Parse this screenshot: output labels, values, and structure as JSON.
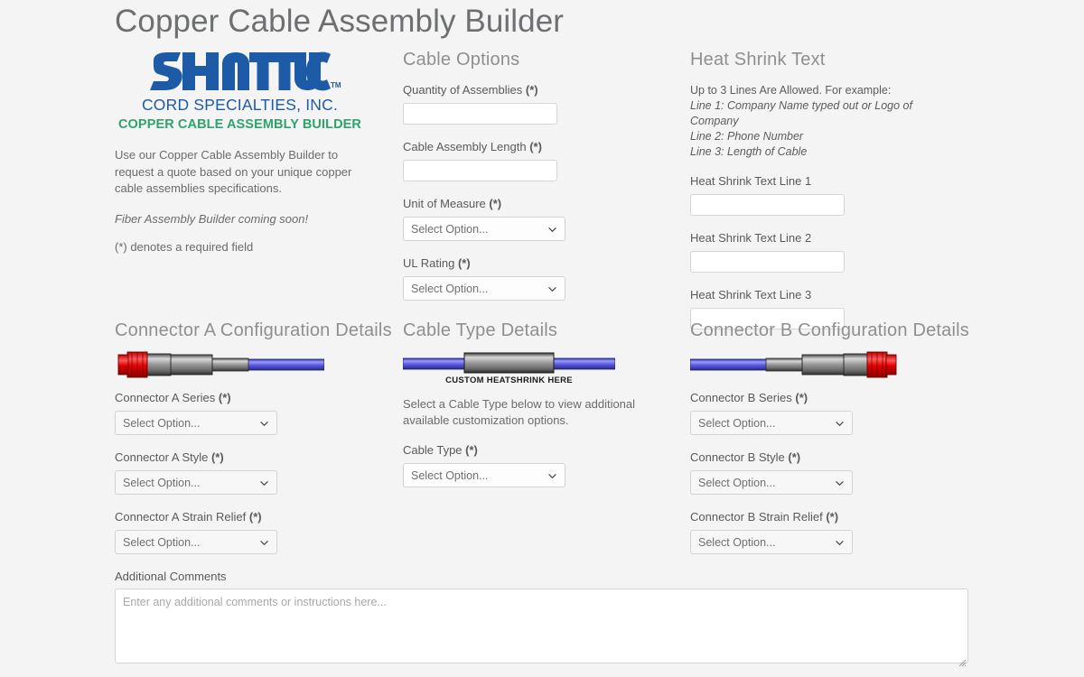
{
  "page": {
    "title": "Copper Cable Assembly Builder",
    "background_color": "#f4f4f4"
  },
  "brand": {
    "wordmark": "SHATTUC",
    "trademark": "TM",
    "subtitle": "CORD SPECIALTIES, INC.",
    "tagline": "COPPER CABLE ASSEMBLY BUILDER",
    "brand_blue": "#1d5ba6",
    "brand_green": "#2fa36b"
  },
  "intro": {
    "paragraph": "Use our Copper Cable Assembly Builder to request a quote based on your unique copper cable assemblies specifications.",
    "italic_note": "Fiber Assembly Builder coming soon!",
    "required_note": "(*) denotes a required field"
  },
  "cable_options": {
    "heading": "Cable Options",
    "quantity": {
      "label": "Quantity of Assemblies",
      "required_marker": "(*)",
      "value": "",
      "placeholder": ""
    },
    "length": {
      "label": "Cable Assembly Length",
      "required_marker": "(*)",
      "value": "",
      "placeholder": ""
    },
    "unit_of_measure": {
      "label": "Unit of Measure",
      "required_marker": "(*)",
      "selected": "Select Option..."
    },
    "ul_rating": {
      "label": "UL Rating",
      "required_marker": "(*)",
      "selected": "Select Option..."
    }
  },
  "heat_shrink": {
    "heading": "Heat Shrink Text",
    "example_intro": "Up to 3 Lines Are Allowed. For example:",
    "example_line_1": "Line 1: Company Name typed out or Logo of Company",
    "example_line_2": "Line 2: Phone Number",
    "example_line_3": "Line 3: Length of Cable",
    "line1": {
      "label": "Heat Shrink Text Line 1",
      "value": "",
      "placeholder": ""
    },
    "line2": {
      "label": "Heat Shrink Text Line 2",
      "value": "",
      "placeholder": ""
    },
    "line3": {
      "label": "Heat Shrink Text Line 3",
      "value": "",
      "placeholder": ""
    }
  },
  "connector_a": {
    "heading": "Connector A Configuration Details",
    "series": {
      "label": "Connector A Series",
      "required_marker": "(*)",
      "selected": "Select Option..."
    },
    "style": {
      "label": "Connector A Style",
      "required_marker": "(*)",
      "selected": "Select Option..."
    },
    "strain_relief": {
      "label": "Connector A Strain Relief",
      "required_marker": "(*)",
      "selected": "Select Option..."
    }
  },
  "cable_type": {
    "heading": "Cable Type Details",
    "graphic_caption": "CUSTOM HEATSHRINK HERE",
    "helper_text": "Select a Cable Type below to view additional available customization options.",
    "type": {
      "label": "Cable Type",
      "required_marker": "(*)",
      "selected": "Select Option..."
    }
  },
  "connector_b": {
    "heading": "Connector B Configuration Details",
    "series": {
      "label": "Connector B Series",
      "required_marker": "(*)",
      "selected": "Select Option..."
    },
    "style": {
      "label": "Connector B Style",
      "required_marker": "(*)",
      "selected": "Select Option..."
    },
    "strain_relief": {
      "label": "Connector B Strain Relief",
      "required_marker": "(*)",
      "selected": "Select Option..."
    }
  },
  "comments": {
    "label": "Additional Comments",
    "value": "",
    "placeholder": "Enter any additional comments or instructions here..."
  },
  "icons": {
    "chevron_down": "chevron-down-icon",
    "resize_grip": "resize-grip-icon",
    "connector_a": "connector-a-diagram-icon",
    "connector_b": "connector-b-diagram-icon",
    "cable": "cable-heatshrink-diagram-icon"
  }
}
